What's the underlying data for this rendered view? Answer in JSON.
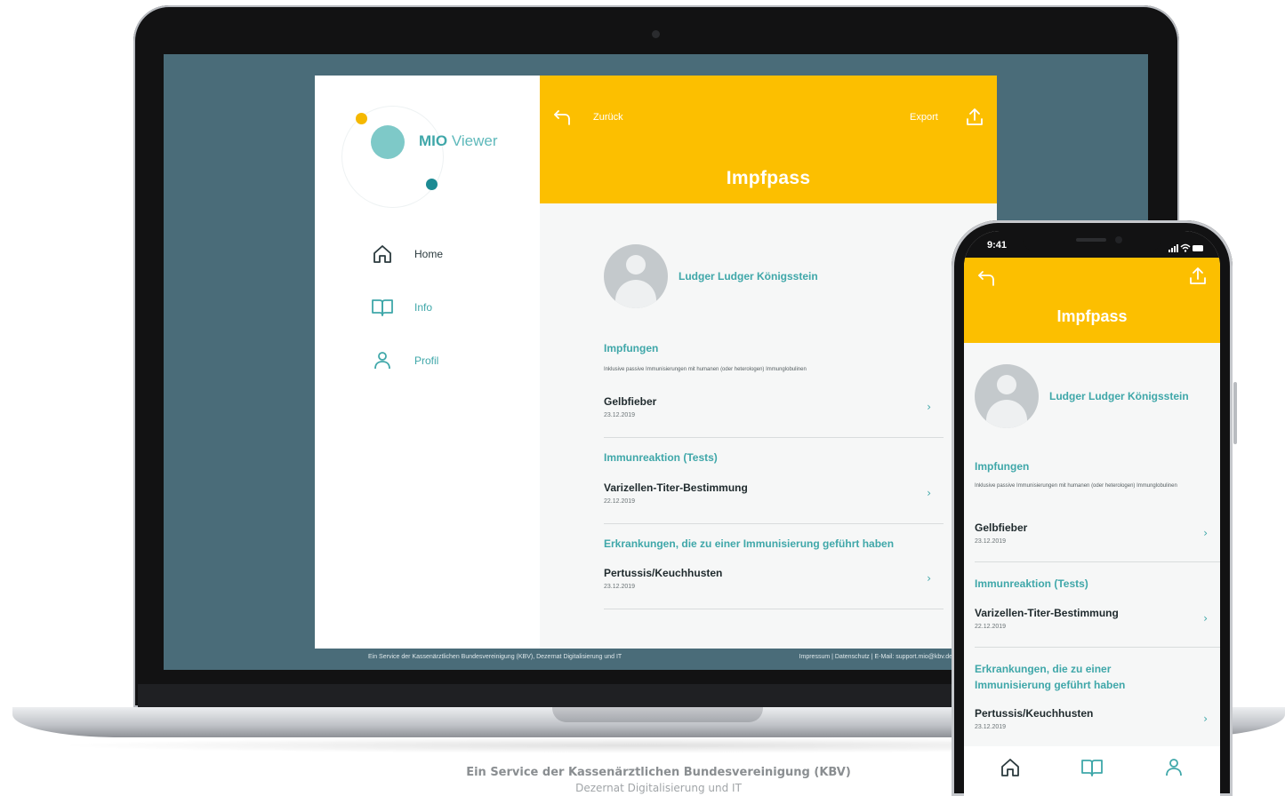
{
  "brand": {
    "logo_bold": "MIO",
    "logo_light": " Viewer",
    "accent": "#3fa7a9",
    "header_color": "#fcbf00"
  },
  "sidebar": {
    "items": [
      {
        "label": "Home",
        "icon": "home-icon"
      },
      {
        "label": "Info",
        "icon": "book-icon"
      },
      {
        "label": "Profil",
        "icon": "user-icon"
      }
    ]
  },
  "header": {
    "back_label": "Zurück",
    "export_label": "Export",
    "title": "Impfpass"
  },
  "patient": {
    "name": "Ludger Ludger Königsstein"
  },
  "sections": {
    "impfungen": {
      "heading": "Impfungen",
      "subtitle": "Inklusive passive Immunisierungen mit humanen (oder heterologen) Immunglobulinen",
      "entries": [
        {
          "title": "Gelbfieber",
          "date": "23.12.2019"
        }
      ]
    },
    "immunreaktion": {
      "heading": "Immunreaktion (Tests)",
      "entries": [
        {
          "title": "Varizellen-Titer-Bestimmung",
          "date": "22.12.2019"
        }
      ]
    },
    "erkrankungen": {
      "heading": "Erkrankungen, die zu einer Immunisierung geführt haben",
      "entries": [
        {
          "title": "Pertussis/Keuchhusten",
          "date": "23.12.2019"
        }
      ]
    }
  },
  "footer": {
    "left": "Ein Service der Kassenärztlichen Bundesvereinigung (KBV), Dezernat Digitalisierung und IT",
    "right": "Impressum  |  Datenschutz  |  E-Mail: support.mio@kbv.de"
  },
  "phone": {
    "time": "9:41",
    "title": "Impfpass",
    "erkrankungen_heading_line1": "Erkrankungen, die zu einer",
    "erkrankungen_heading_line2": "Immunisierung geführt haben",
    "tabs": [
      "home-icon",
      "book-icon",
      "user-icon"
    ]
  },
  "caption": {
    "line1": "Ein Service der Kassenärztlichen Bundesvereinigung (KBV)",
    "line2": "Dezernat Digitalisierung und IT"
  }
}
